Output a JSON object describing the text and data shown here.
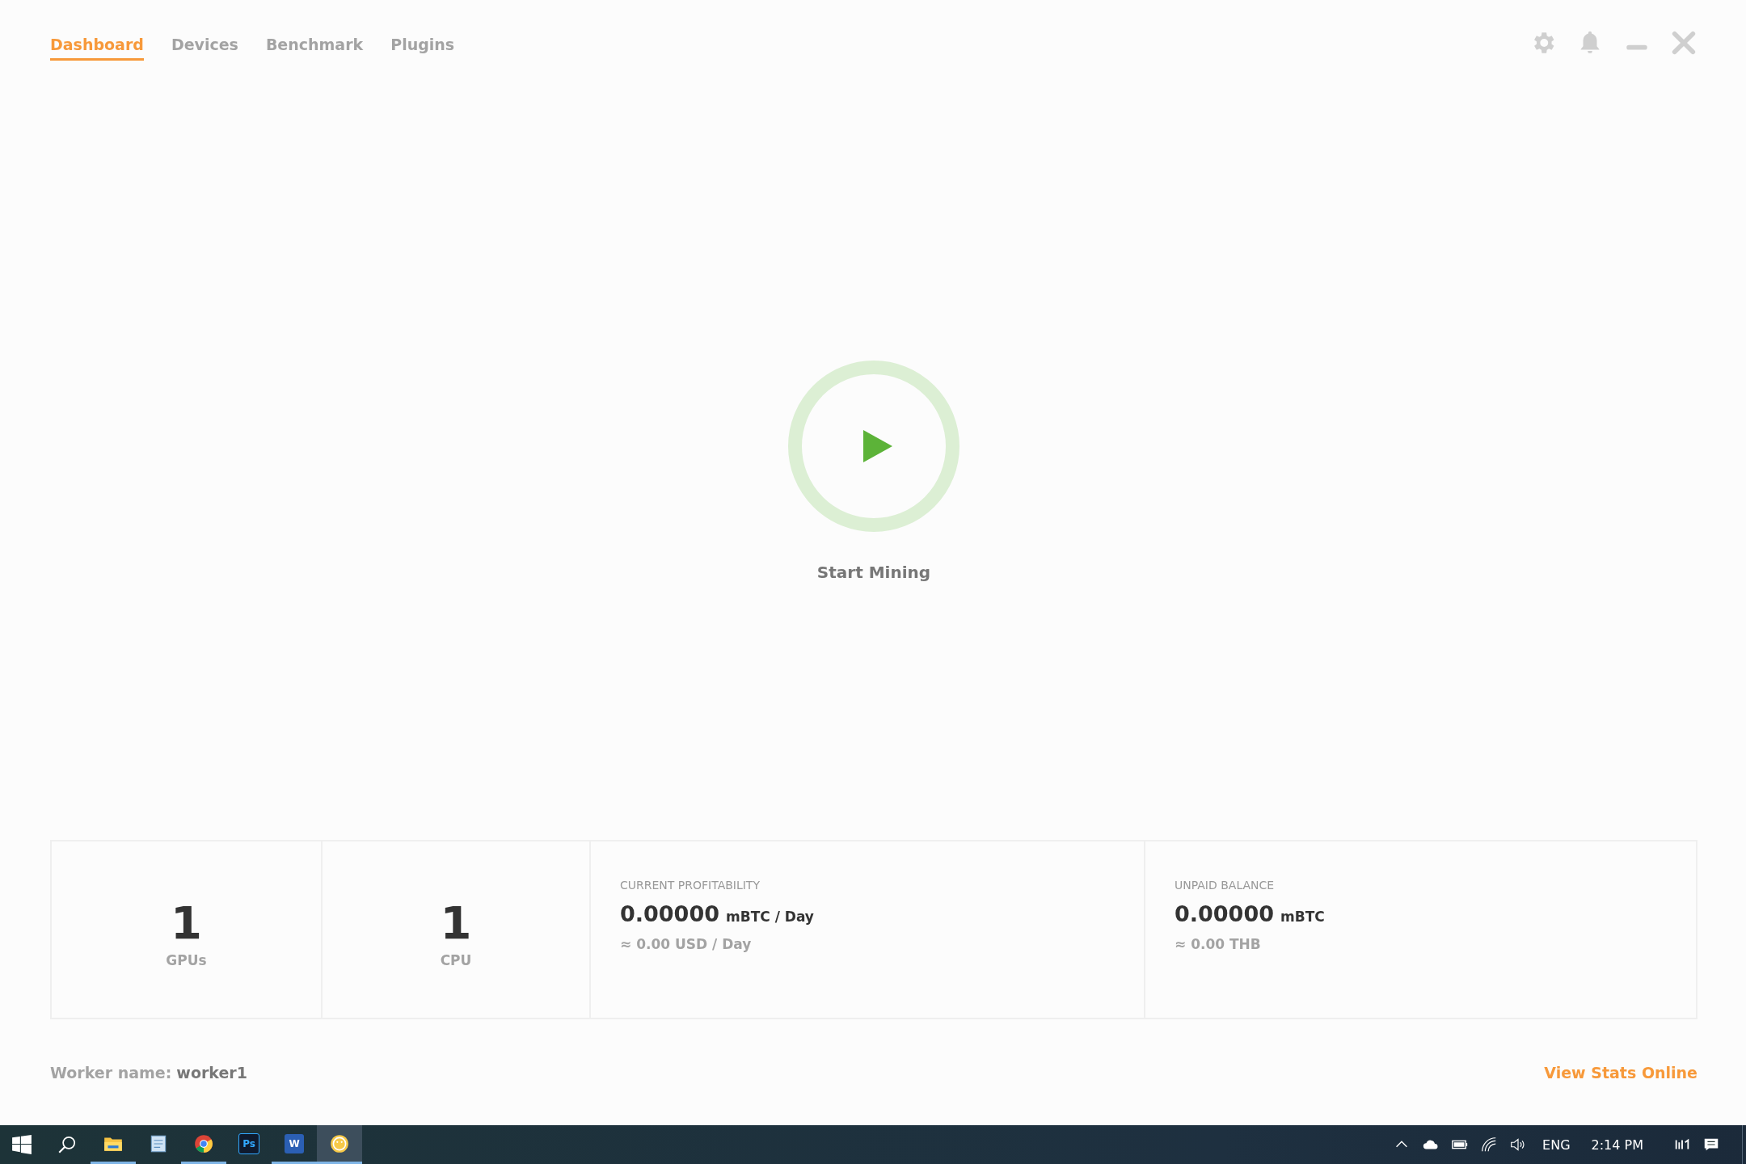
{
  "tabs": [
    {
      "label": "Dashboard",
      "selected": true
    },
    {
      "label": "Devices",
      "selected": false
    },
    {
      "label": "Benchmark",
      "selected": false
    },
    {
      "label": "Plugins",
      "selected": false
    }
  ],
  "start": {
    "label": "Start Mining"
  },
  "stats": [
    {
      "kind": "count",
      "value": "1",
      "label": "GPUs"
    },
    {
      "kind": "count",
      "value": "1",
      "label": "CPU"
    },
    {
      "kind": "money",
      "title": "CURRENT PROFITABILITY",
      "value": "0.00000",
      "unit": "mBTC / Day",
      "sub": "≈ 0.00 USD / Day"
    },
    {
      "kind": "money",
      "title": "UNPAID BALANCE",
      "value": "0.00000",
      "unit": "mBTC",
      "sub": "≈ 0.00 THB"
    }
  ],
  "footer": {
    "worker_label": "Worker name:",
    "worker": "worker1",
    "link": "View Stats Online"
  },
  "taskbar": {
    "apps": [
      {
        "kind": "files",
        "running": true,
        "selected": false
      },
      {
        "kind": "notepad",
        "running": false,
        "selected": false
      },
      {
        "kind": "chrome",
        "running": true,
        "selected": false
      },
      {
        "kind": "ps",
        "label": "Ps",
        "running": false,
        "selected": false
      },
      {
        "kind": "word",
        "label": "W",
        "running": true,
        "selected": false
      },
      {
        "kind": "miner",
        "running": true,
        "selected": true
      }
    ],
    "language": "ENG",
    "time": "2:14 PM"
  }
}
